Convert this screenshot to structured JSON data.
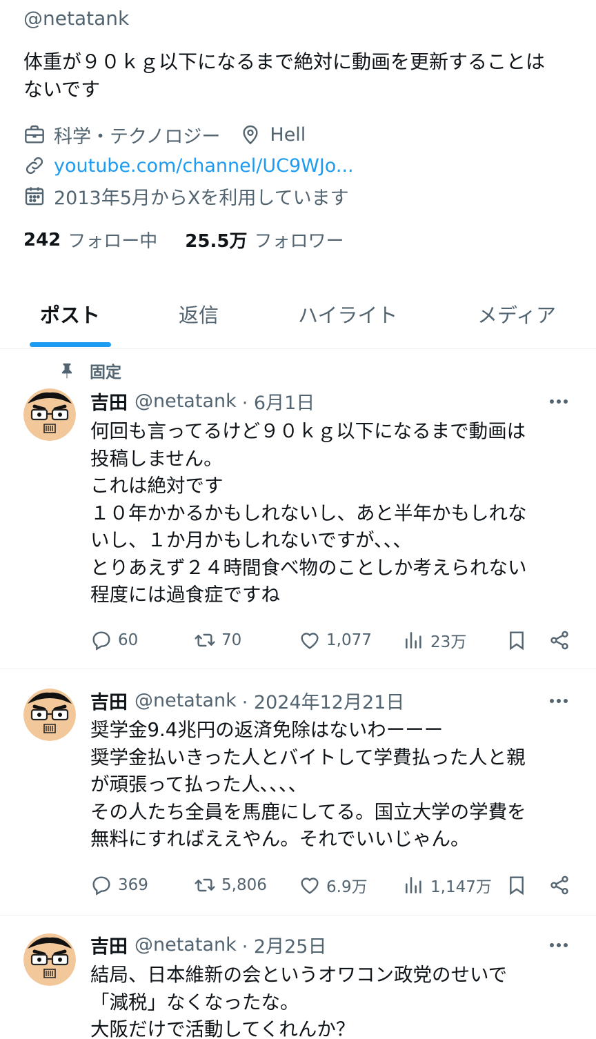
{
  "profile": {
    "handle": "@netatank",
    "bio_lines": [
      "体重が９０ｋｇ以下になるまで絶対に動画を更新することは",
      "ないです"
    ],
    "category": "科学・テクノロジー",
    "location": "Hell",
    "link": "youtube.com/channel/UC9WJo...",
    "joined": "2013年5月からXを利用しています",
    "following_count": "242",
    "following_label": "フォロー中",
    "followers_count": "25.5万",
    "followers_label": "フォロワー"
  },
  "tabs": [
    "ポスト",
    "返信",
    "ハイライト",
    "メディア"
  ],
  "pinned_label": "固定",
  "posts": [
    {
      "name": "吉田",
      "handle": "@netatank",
      "date": "· 6月1日",
      "lines": [
        "何回も言ってるけど９０ｋｇ以下になるまで動画は",
        "投稿しません。",
        "これは絶対です",
        "１０年かかるかもしれないし、あと半年かもしれな",
        "いし、１か月かもしれないですが､､､",
        "とりあえず２４時間食べ物のことしか考えられない",
        "程度には過食症ですね"
      ],
      "replies": "60",
      "reposts": "70",
      "likes": "1,077",
      "views": "23万"
    },
    {
      "name": "吉田",
      "handle": "@netatank",
      "date": "· 2024年12月21日",
      "lines": [
        "奨学金9.4兆円の返済免除はないわーーー",
        "奨学金払いきった人とバイトして学費払った人と親",
        "が頑張って払った人､､､､",
        "その人たち全員を馬鹿にしてる。国立大学の学費を",
        "無料にすればええやん。それでいいじゃん。"
      ],
      "replies": "369",
      "reposts": "5,806",
      "likes": "6.9万",
      "views": "1,147万"
    },
    {
      "name": "吉田",
      "handle": "@netatank",
      "date": "· 2月25日",
      "lines": [
        "結局、日本維新の会というオワコン政党のせいで",
        "「減税」なくなったな。",
        "大阪だけで活動してくれんか？"
      ],
      "replies": "",
      "reposts": "",
      "likes": "",
      "views": ""
    }
  ],
  "colors": {
    "accent": "#1d9bf0",
    "muted": "#536471",
    "text": "#0f1419"
  },
  "icons": {
    "category": "briefcase-icon",
    "location": "location-pin-icon",
    "link": "link-icon",
    "joined": "calendar-icon",
    "pinned": "pin-icon",
    "reply": "reply-icon",
    "repost": "repost-icon",
    "like": "heart-icon",
    "views": "views-icon",
    "bookmark": "bookmark-icon",
    "share": "share-icon",
    "more": "more-icon"
  }
}
